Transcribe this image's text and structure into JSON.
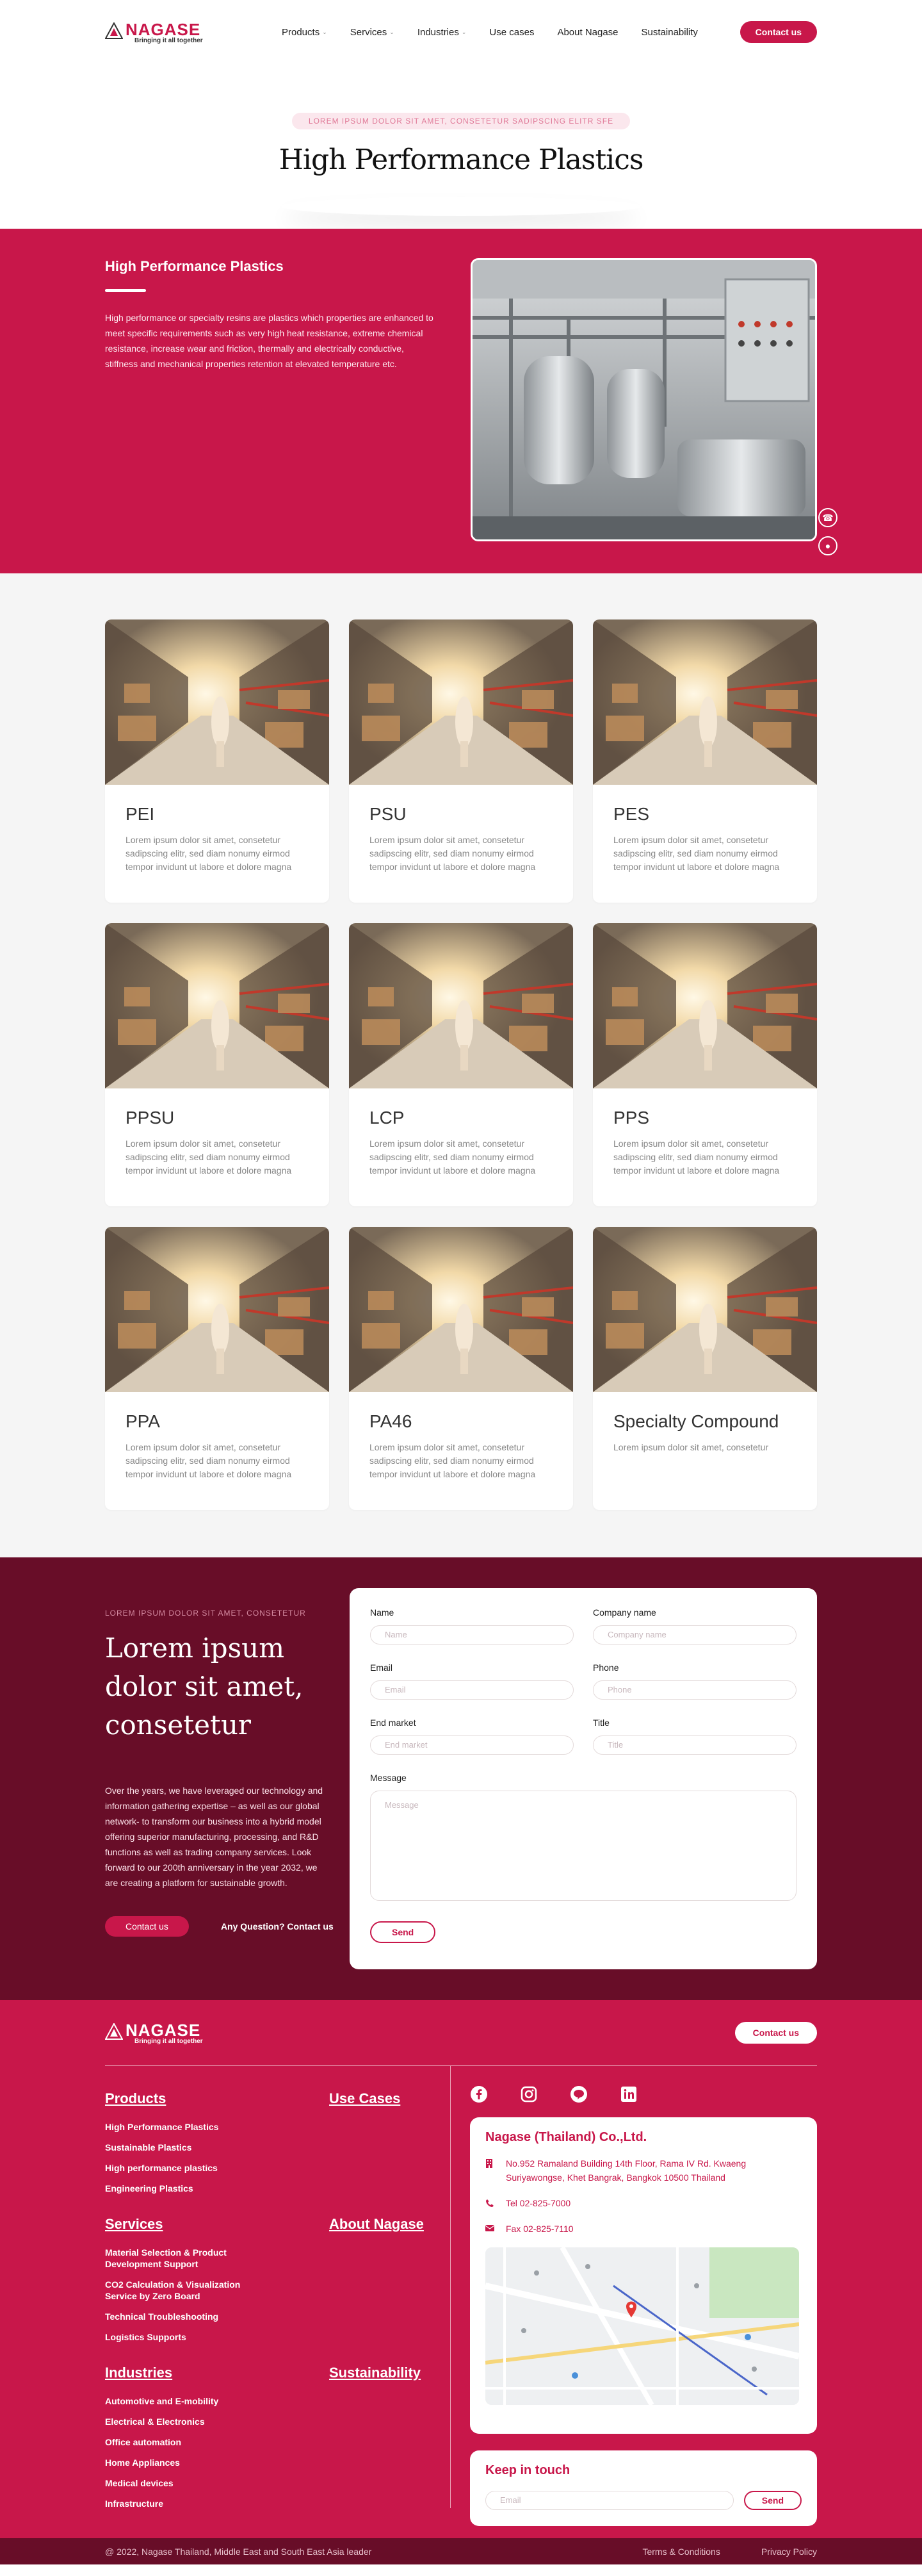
{
  "header": {
    "brand": "NAGASE",
    "tagline": "Bringing it all together",
    "nav": [
      {
        "label": "Products",
        "dropdown": true
      },
      {
        "label": "Services",
        "dropdown": true
      },
      {
        "label": "Industries",
        "dropdown": true
      },
      {
        "label": "Use cases",
        "dropdown": false
      },
      {
        "label": "About Nagase",
        "dropdown": false
      },
      {
        "label": "Sustainability",
        "dropdown": false
      }
    ],
    "contact_label": "Contact us"
  },
  "hero": {
    "eyebrow": "LOREM IPSUM DOLOR SIT AMET, CONSETETUR  SADIPSCING ELITR SFE",
    "title": "High Performance Plastics"
  },
  "intro": {
    "heading": "High Performance Plastics",
    "body": "High performance or specialty resins are plastics which properties are enhanced to meet specific requirements such as very high heat resistance, extreme chemical resistance, increase wear and friction, thermally and electrically conductive, stiffness and mechanical properties retention at elevated temperature etc."
  },
  "products": [
    {
      "title": "PEI",
      "desc": "Lorem ipsum dolor sit amet, consetetur sadipscing elitr, sed diam nonumy eirmod tempor invidunt ut labore et dolore magna"
    },
    {
      "title": "PSU",
      "desc": "Lorem ipsum dolor sit amet, consetetur sadipscing elitr, sed diam nonumy eirmod tempor invidunt ut labore et dolore magna"
    },
    {
      "title": "PES",
      "desc": "Lorem ipsum dolor sit amet, consetetur sadipscing elitr, sed diam nonumy eirmod tempor invidunt ut labore et dolore magna"
    },
    {
      "title": "PPSU",
      "desc": "Lorem ipsum dolor sit amet, consetetur sadipscing elitr, sed diam nonumy eirmod tempor invidunt ut labore et dolore magna"
    },
    {
      "title": "LCP",
      "desc": "Lorem ipsum dolor sit amet, consetetur sadipscing elitr, sed diam nonumy eirmod tempor invidunt ut labore et dolore magna"
    },
    {
      "title": "PPS",
      "desc": "Lorem ipsum dolor sit amet, consetetur sadipscing elitr, sed diam nonumy eirmod tempor invidunt ut labore et dolore magna"
    },
    {
      "title": "PPA",
      "desc": "Lorem ipsum dolor sit amet, consetetur sadipscing elitr, sed diam nonumy eirmod tempor invidunt ut labore et dolore magna"
    },
    {
      "title": "PA46",
      "desc": "Lorem ipsum dolor sit amet, consetetur sadipscing elitr, sed diam nonumy eirmod tempor invidunt ut labore et dolore magna"
    },
    {
      "title": "Specialty Compound",
      "desc": "Lorem ipsum dolor sit amet, consetetur"
    }
  ],
  "contact": {
    "eyebrow": "LOREM IPSUM DOLOR SIT AMET, CONSETETUR",
    "heading": "Lorem ipsum dolor sit amet, consetetur",
    "body": "Over the years, we have leveraged our technology and information gathering expertise – as well as our global network- to transform our business into a hybrid model offering superior manufacturing, processing, and R&D functions as well as trading company services. Look forward to our 200th anniversary in the year 2032, we are creating a platform for sustainable growth.",
    "contact_label": "Contact us",
    "question_label": "Any Question? Contact us",
    "form": {
      "name_label": "Name",
      "name_ph": "Name",
      "company_label": "Company name",
      "company_ph": "Company name",
      "email_label": "Email",
      "email_ph": "Email",
      "phone_label": "Phone",
      "phone_ph": "Phone",
      "market_label": "End market",
      "market_ph": "End market",
      "title_label": "Title",
      "title_ph": "Title",
      "message_label": "Message",
      "message_ph": "Message",
      "send_label": "Send"
    }
  },
  "footer": {
    "brand": "NAGASE",
    "tagline": "Bringing it all together",
    "contact_label": "Contact us",
    "products_heading": "Products",
    "products_links": [
      "High Performance Plastics",
      "Sustainable Plastics",
      "High performance plastics",
      "Engineering Plastics"
    ],
    "usecases_heading": "Use Cases",
    "services_heading": "Services",
    "services_links": [
      "Material Selection & Product Development Support",
      "CO2 Calculation & Visualization Service by Zero Board",
      "Technical Troubleshooting",
      "Logistics Supports"
    ],
    "about_heading": "About Nagase",
    "industries_heading": "Industries",
    "industries_links": [
      "Automotive and E-mobility",
      "Electrical & Electronics",
      "Office automation",
      "Home Appliances",
      "Medical devices",
      "Infrastructure"
    ],
    "sustainability_heading": "Sustainability",
    "social": [
      "facebook-icon",
      "instagram-icon",
      "line-icon",
      "linkedin-icon"
    ],
    "company": {
      "name": "Nagase (Thailand) Co.,Ltd.",
      "address": "No.952 Ramaland Building 14th Floor, Rama IV Rd. Kwaeng Suriyawongse, Khet Bangrak, Bangkok 10500 Thailand",
      "tel": "Tel 02-825-7000",
      "fax": "Fax 02-825-7110"
    },
    "keep_heading": "Keep in touch",
    "keep_ph": "Email",
    "keep_send": "Send",
    "copyright": "@ 2022, Nagase Thailand, Middle East and  South East Asia leader",
    "terms": "Terms & Conditions",
    "privacy": "Privacy Policy"
  },
  "colors": {
    "brand": "#c8174a",
    "dark": "#680d28",
    "light_bg": "#f5f5f5"
  }
}
